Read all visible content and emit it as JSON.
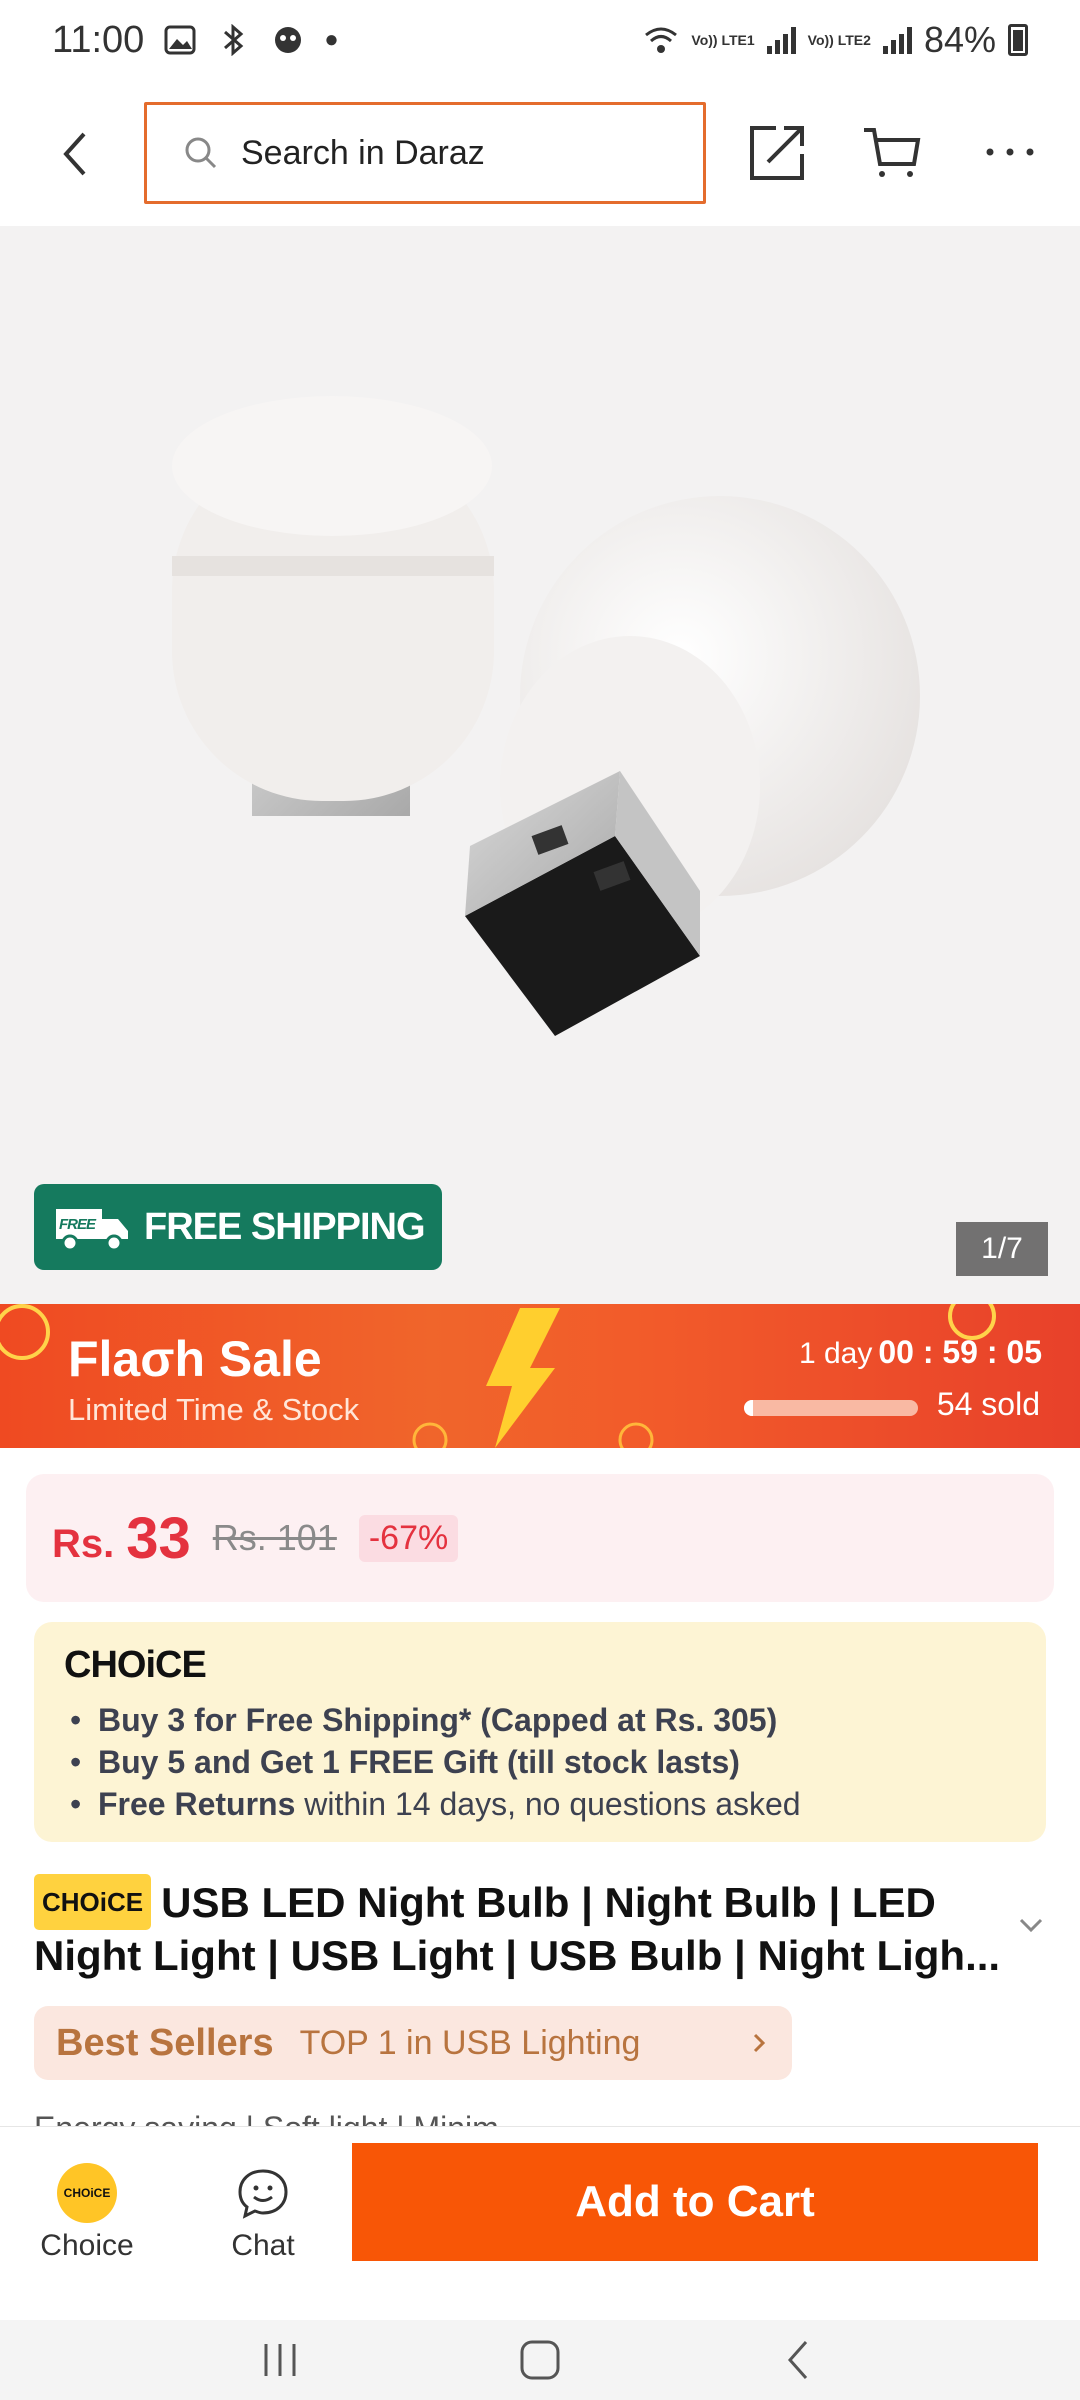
{
  "status_bar": {
    "time": "11:00",
    "network1": "Vo)) LTE1",
    "network2": "Vo)) LTE2",
    "battery": "84%"
  },
  "search": {
    "placeholder": "Search in Daraz"
  },
  "gallery": {
    "free_shipping_label": "FREE SHIPPING",
    "free_badge": "FREE",
    "pager": "1/7"
  },
  "flash_sale": {
    "title": "Flaσh  Sale",
    "subtitle": "Limited Time & Stock",
    "days": "1 day",
    "timer": "00 : 59 : 05",
    "sold": "54 sold",
    "sold_progress": 0.05
  },
  "price": {
    "currency": "Rs.",
    "current": "33",
    "original": "Rs. 101",
    "discount": "-67%"
  },
  "choice": {
    "logo": "CHOiCE",
    "benefits": [
      {
        "bold": "Buy 3 for  Free Shipping* (Capped at Rs. 305)",
        "rest": ""
      },
      {
        "bold": "Buy 5 and Get 1 FREE Gift (till stock lasts)",
        "rest": ""
      },
      {
        "bold": "Free Returns",
        "rest": " within 14 days, no questions asked"
      }
    ]
  },
  "product": {
    "tag": "CHOiCE",
    "title": "USB LED Night Bulb | Night Bulb | LED Night Light | USB Light | USB Bulb | Night Ligh..."
  },
  "best_sellers": {
    "title": "Best Sellers",
    "rank": "TOP 1 in USB Lighting"
  },
  "features": "Energy saving | Soft light | Minim...",
  "action_bar": {
    "choice_label": "Choice",
    "choice_coin": "CHOiCE",
    "chat_label": "Chat",
    "add_to_cart": "Add to Cart"
  },
  "colors": {
    "brand_orange": "#f85606",
    "search_border": "#e46c2d",
    "price_red": "#e4323f",
    "free_ship_green": "#157a5e",
    "choice_yellow": "#ffd23f"
  }
}
